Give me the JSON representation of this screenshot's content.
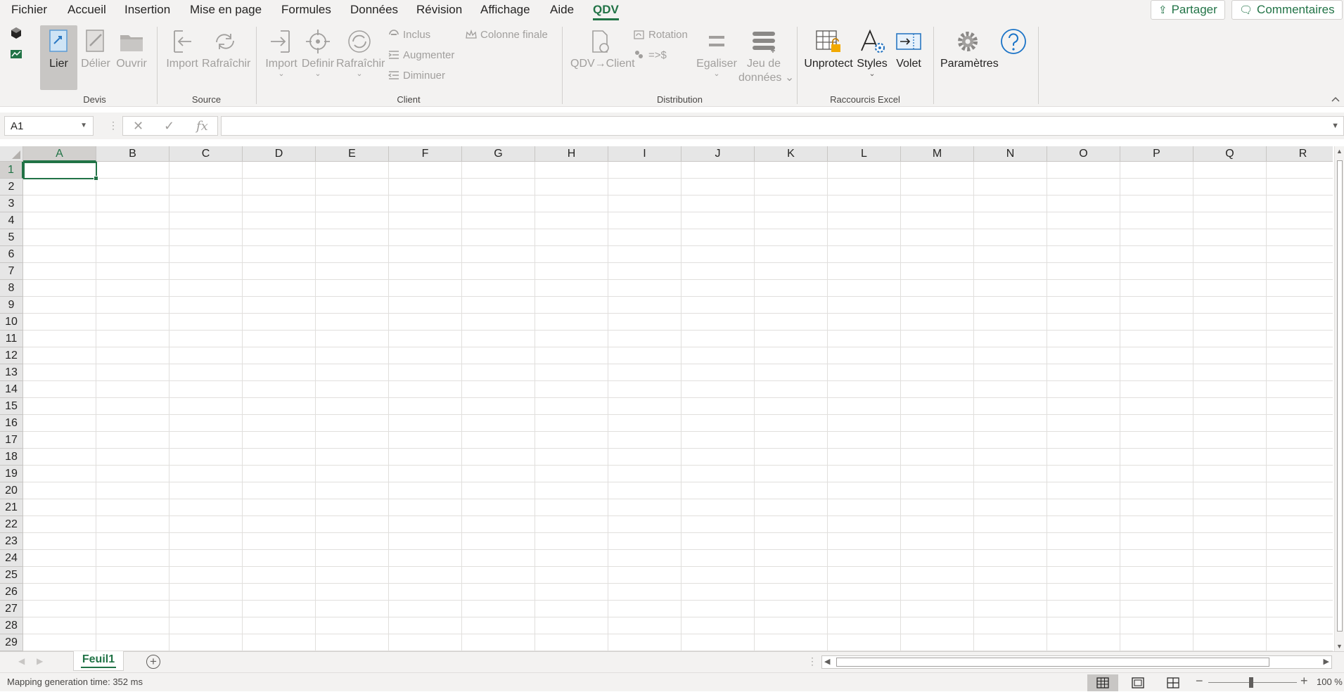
{
  "menu": {
    "tabs": [
      "Fichier",
      "Accueil",
      "Insertion",
      "Mise en page",
      "Formules",
      "Données",
      "Révision",
      "Affichage",
      "Aide",
      "QDV"
    ],
    "active_tab": "QDV",
    "share_label": "Partager",
    "comments_label": "Commentaires"
  },
  "ribbon": {
    "devis": {
      "group_label": "Devis",
      "lier": "Lier",
      "delier": "Délier",
      "ouvrir": "Ouvrir"
    },
    "source": {
      "group_label": "Source",
      "import": "Import",
      "rafraichir": "Rafraîchir"
    },
    "client": {
      "group_label": "Client",
      "import": "Import",
      "definir": "Definir",
      "rafraichir": "Rafraîchir",
      "inclus": "Inclus",
      "augmenter": "Augmenter",
      "diminuer": "Diminuer",
      "colonne_finale": "Colonne finale"
    },
    "distribution": {
      "group_label": "Distribution",
      "qdv_client": "QDV→Client",
      "rotation": "Rotation",
      "currency": "=>$",
      "egaliser": "Egaliser",
      "jeu_de_donnees_line1": "Jeu de",
      "jeu_de_donnees_line2": "données"
    },
    "raccourcis": {
      "group_label": "Raccourcis Excel",
      "unprotect": "Unprotect",
      "styles": "Styles",
      "volet": "Volet"
    },
    "parametres": "Paramètres"
  },
  "formula_bar": {
    "name_box": "A1",
    "formula": ""
  },
  "grid": {
    "columns": [
      "A",
      "B",
      "C",
      "D",
      "E",
      "F",
      "G",
      "H",
      "I",
      "J",
      "K",
      "L",
      "M",
      "N",
      "O",
      "P",
      "Q",
      "R"
    ],
    "rows": [
      "1",
      "2",
      "3",
      "4",
      "5",
      "6",
      "7",
      "8",
      "9",
      "10",
      "11",
      "12",
      "13",
      "14",
      "15",
      "16",
      "17",
      "18",
      "19",
      "20",
      "21",
      "22",
      "23",
      "24",
      "25",
      "26",
      "27",
      "28",
      "29"
    ],
    "active_cell": "A1"
  },
  "sheets": {
    "tabs": [
      "Feuil1"
    ],
    "active": "Feuil1"
  },
  "status": {
    "message": "Mapping generation time: 352 ms",
    "zoom": "100 %"
  },
  "colors": {
    "accent": "#217346",
    "ribbon_bg": "#f3f2f1",
    "help_blue": "#1a73c7"
  }
}
